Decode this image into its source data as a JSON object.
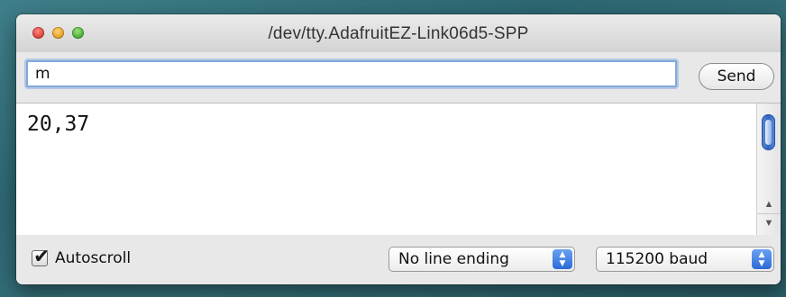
{
  "window": {
    "title": "/dev/tty.AdafruitEZ-Link06d5-SPP"
  },
  "input": {
    "value": "m",
    "send_label": "Send"
  },
  "output": {
    "text": "20,37"
  },
  "footer": {
    "autoscroll_label": "Autoscroll",
    "autoscroll_checked": true,
    "line_ending": "No line ending",
    "baud_rate": "115200 baud"
  },
  "icons": {
    "close": "close-light",
    "minimize": "minimize-light",
    "zoom": "zoom-light",
    "checkmark": "check-icon",
    "select_stepper": "up-down-chevron-icon"
  }
}
